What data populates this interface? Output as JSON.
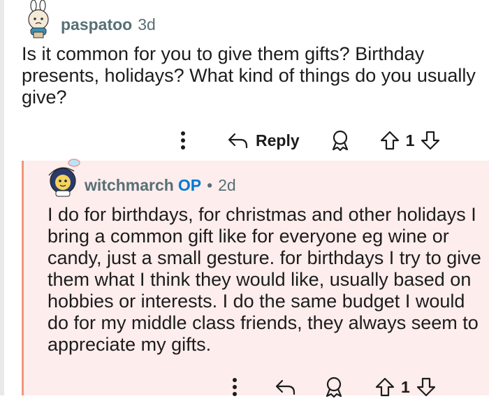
{
  "comments": [
    {
      "author": "paspatoo",
      "time": "3d",
      "body": "Is it common for you to give them gifts? Birthday presents, holidays? What kind of things do you usually give?",
      "reply_label": "Reply",
      "score": "1"
    },
    {
      "author": "witchmarch",
      "op_badge": "OP",
      "separator": "•",
      "time": "2d",
      "body": "I do for birthdays, for christmas and other holidays I bring a common gift like for everyone eg wine or candy, just a small gesture. for birthdays I try to give them what I think they would like, usually based on hobbies or interests. I do the same budget I would do for my middle class friends, they always seem to appreciate my gifts.",
      "score": "1"
    }
  ],
  "icons": [
    "more-options-icon",
    "reply-arrow-icon",
    "award-icon",
    "upvote-icon",
    "downvote-icon"
  ],
  "colors": {
    "username": "#576f76",
    "op": "#0079d3",
    "thread_line": "#f2967c",
    "highlight_bg": "#fdedec"
  }
}
